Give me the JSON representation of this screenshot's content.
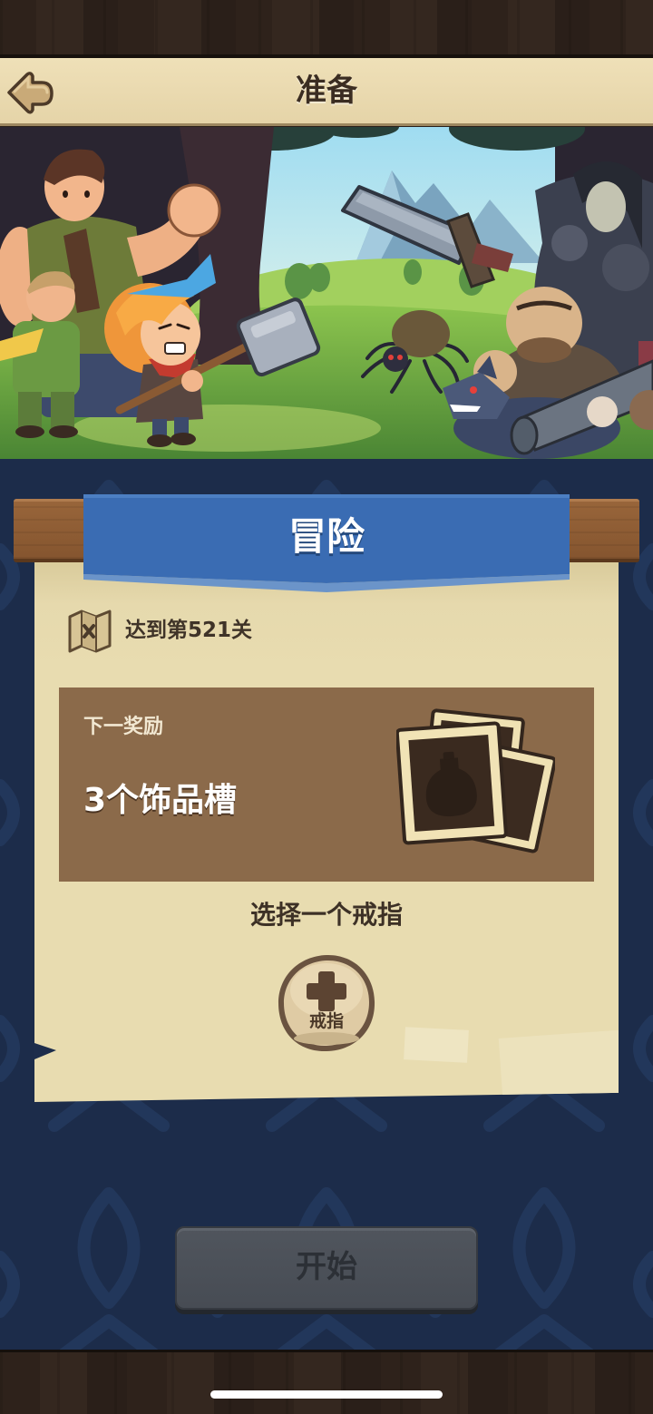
{
  "header": {
    "title": "准备",
    "back_icon": "back-arrow-icon"
  },
  "adventure": {
    "banner_title": "冒险",
    "progress": {
      "icon": "map-icon",
      "text": "达到第521关"
    },
    "next_reward": {
      "label": "下一奖励",
      "value": "3个饰品槽",
      "icon": "accessory-cards-icon"
    },
    "select_prompt": "选择一个戒指",
    "ring_slot": {
      "icon": "plus-icon",
      "label": "戒指"
    }
  },
  "start_button": {
    "label": "开始"
  },
  "colors": {
    "header_beige": "#e8d8ae",
    "banner_blue": "#3a6cb3",
    "parchment": "#e8dcb0",
    "reward_panel": "#8b6a4a",
    "page_background": "#1d2d4b",
    "start_button_disabled": "#4a4f57"
  }
}
